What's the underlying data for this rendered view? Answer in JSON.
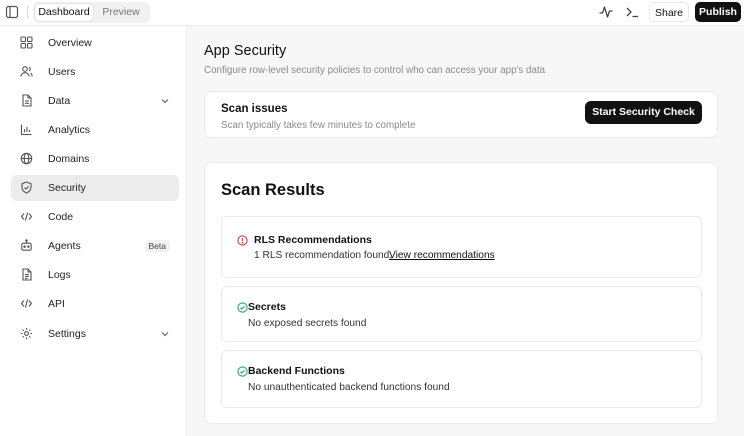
{
  "topbar": {
    "tabs": [
      {
        "label": "Dashboard",
        "active": true
      },
      {
        "label": "Preview",
        "active": false
      }
    ],
    "share_label": "Share",
    "publish_label": "Publish"
  },
  "sidebar": {
    "items": [
      {
        "label": "Overview",
        "icon": "grid-icon"
      },
      {
        "label": "Users",
        "icon": "users-icon"
      },
      {
        "label": "Data",
        "icon": "document-icon",
        "expandable": true
      },
      {
        "label": "Analytics",
        "icon": "bar-chart-icon"
      },
      {
        "label": "Domains",
        "icon": "globe-icon"
      },
      {
        "label": "Security",
        "icon": "shield-icon",
        "active": true
      },
      {
        "label": "Code",
        "icon": "code-icon"
      },
      {
        "label": "Agents",
        "icon": "bot-icon",
        "badge": "Beta"
      },
      {
        "label": "Logs",
        "icon": "file-text-icon"
      },
      {
        "label": "API",
        "icon": "code-icon"
      },
      {
        "label": "Settings",
        "icon": "gear-icon",
        "expandable": true
      }
    ]
  },
  "page": {
    "title": "App Security",
    "subtitle": "Configure row-level security policies to control who can access your app's data"
  },
  "scan": {
    "title": "Scan issues",
    "subtitle": "Scan typically takes few minutes to complete",
    "button_label": "Start Security Check"
  },
  "results": {
    "title": "Scan Results",
    "items": [
      {
        "title": "RLS Recommendations",
        "text": "1 RLS recommendation found,",
        "link": "View recommendations",
        "status": "warning"
      },
      {
        "title": "Secrets",
        "text": "No exposed secrets found",
        "status": "ok"
      },
      {
        "title": "Backend Functions",
        "text": "No unauthenticated backend functions found",
        "status": "ok"
      }
    ]
  },
  "colors": {
    "accent": "#111111",
    "warning": "#dc3b3b",
    "success": "#2fa66a",
    "active_nav": "#ececed"
  }
}
